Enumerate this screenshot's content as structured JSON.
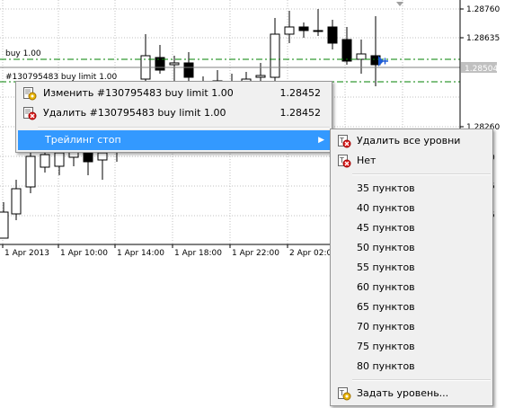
{
  "chart": {
    "price_labels": [
      "1.28760",
      "1.28635",
      "1.28504",
      "1.28260"
    ],
    "current_price": "1.28504",
    "right_edge_partial_labels": [
      "0",
      "5",
      "5"
    ],
    "time_labels": [
      "1 Apr 2013",
      "1 Apr 10:00",
      "1 Apr 14:00",
      "1 Apr 18:00",
      "1 Apr 22:00",
      "2 Apr 02:0"
    ],
    "order_label_buy": "buy 1.00",
    "order_label_buy_limit": "#130795483 buy limit 1.00",
    "colors": {
      "grid": "#c0c0c0",
      "order_line": "#008000",
      "bid_line": "#808080",
      "candle": "#000000",
      "menu_highlight": "#3399ff"
    }
  },
  "context_menu": {
    "items": [
      {
        "icon": "edit-order-icon",
        "label": "Изменить #130795483 buy limit 1.00",
        "value": "1.28452"
      },
      {
        "icon": "delete-order-icon",
        "label": "Удалить #130795483 buy limit 1.00",
        "value": "1.28452"
      }
    ],
    "trailing_stop": {
      "label": "Трейлинг стоп",
      "arrow": "▶"
    }
  },
  "submenu": {
    "delete_all": "Удалить все уровни",
    "none": "Нет",
    "levels": [
      "35 пунктов",
      "40 пунктов",
      "45 пунктов",
      "50 пунктов",
      "55 пунктов",
      "60 пунктов",
      "65 пунктов",
      "70 пунктов",
      "75 пунктов",
      "80 пунктов"
    ],
    "set_level": "Задать уровень..."
  }
}
